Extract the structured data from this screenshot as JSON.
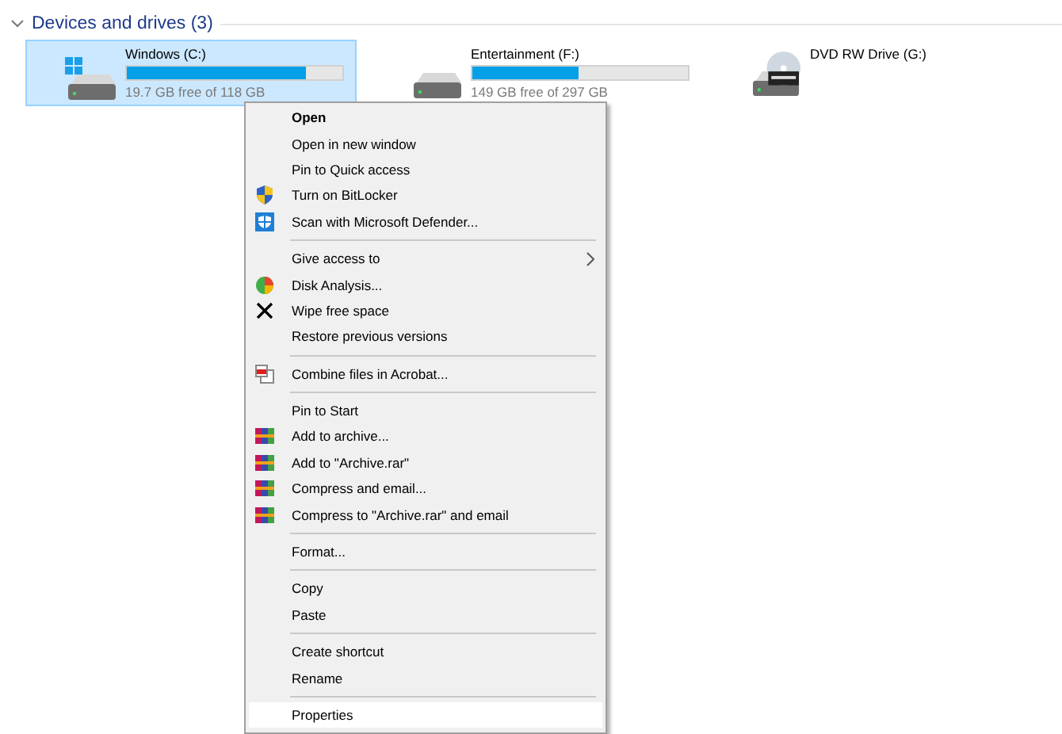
{
  "group": {
    "title": "Devices and drives (3)",
    "expanded": true
  },
  "drives": [
    {
      "kind": "windows",
      "name": "Windows (C:)",
      "level": 0.83,
      "free": "19.7 GB free of 118 GB",
      "selected": true
    },
    {
      "kind": "disk",
      "name": "Entertainment (F:)",
      "level": 0.49,
      "free": "149 GB free of 297 GB",
      "selected": false
    },
    {
      "kind": "dvd",
      "name": "DVD RW Drive (G:)",
      "selected": false
    }
  ],
  "context_menu": [
    {
      "kind": "item",
      "label": "Open",
      "default": true,
      "selected": false
    },
    {
      "kind": "item",
      "label": "Open in new window",
      "default": false,
      "selected": false
    },
    {
      "kind": "item",
      "label": "Pin to Quick access",
      "default": false,
      "selected": false
    },
    {
      "kind": "shield",
      "label": "Turn on BitLocker",
      "default": false,
      "selected": false
    },
    {
      "kind": "defender",
      "label": "Scan with Microsoft Defender...",
      "default": false,
      "selected": false
    },
    {
      "kind": "separator"
    },
    {
      "kind": "submenu",
      "label": "Give access to",
      "default": false,
      "selected": false
    },
    {
      "kind": "pie",
      "label": "Disk Analysis...",
      "default": false,
      "selected": false
    },
    {
      "kind": "cross",
      "label": "Wipe free space",
      "default": false,
      "selected": false
    },
    {
      "kind": "item",
      "label": "Restore previous versions",
      "default": false,
      "selected": false
    },
    {
      "kind": "separator"
    },
    {
      "kind": "acrobat",
      "label": "Combine files in Acrobat...",
      "default": false,
      "selected": false
    },
    {
      "kind": "separator"
    },
    {
      "kind": "item",
      "label": "Pin to Start",
      "default": false,
      "selected": false
    },
    {
      "kind": "archive",
      "label": "Add to archive...",
      "default": false,
      "selected": false
    },
    {
      "kind": "archive",
      "label": "Add to \"Archive.rar\"",
      "default": false,
      "selected": false
    },
    {
      "kind": "archive",
      "label": "Compress and email...",
      "default": false,
      "selected": false
    },
    {
      "kind": "archive",
      "label": "Compress to \"Archive.rar\" and email",
      "default": false,
      "selected": false
    },
    {
      "kind": "separator"
    },
    {
      "kind": "item",
      "label": "Format...",
      "default": false,
      "selected": false
    },
    {
      "kind": "separator"
    },
    {
      "kind": "item",
      "label": "Copy",
      "default": false,
      "selected": false
    },
    {
      "kind": "item",
      "label": "Paste",
      "default": false,
      "selected": false
    },
    {
      "kind": "separator"
    },
    {
      "kind": "item",
      "label": "Create shortcut",
      "default": false,
      "selected": false
    },
    {
      "kind": "item",
      "label": "Rename",
      "default": false,
      "selected": false
    },
    {
      "kind": "separator"
    },
    {
      "kind": "item",
      "label": "Properties",
      "default": false,
      "selected": true
    }
  ]
}
